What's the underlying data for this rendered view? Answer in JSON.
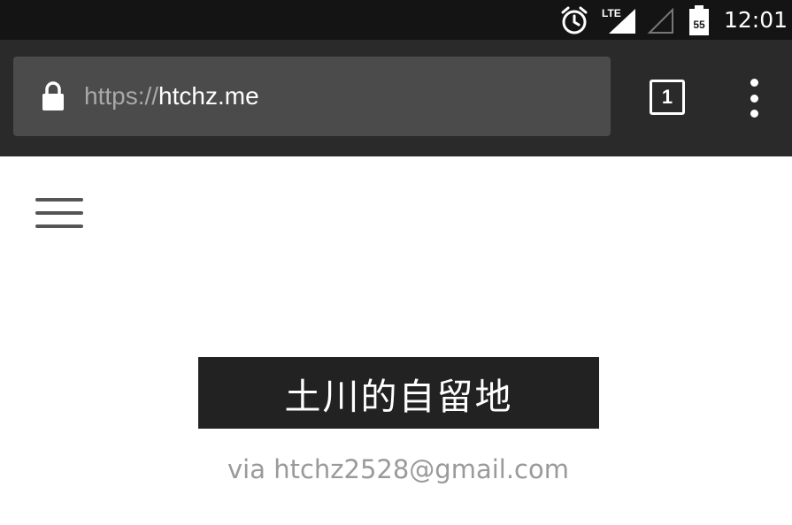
{
  "status_bar": {
    "time": "12:01",
    "network": "LTE",
    "battery_level": "55",
    "icons": [
      "alarm-icon",
      "lte-signal-icon",
      "signal-empty-icon",
      "battery-icon"
    ]
  },
  "browser": {
    "url_scheme": "https://",
    "url_host": "htchz.me",
    "tab_count": "1",
    "icons": [
      "lock-icon",
      "tabs-icon",
      "overflow-menu-icon"
    ]
  },
  "page": {
    "menu_icon": "hamburger-menu-icon",
    "site_title": "土川的自留地",
    "contact": "via htchz2528@gmail.com"
  },
  "colors": {
    "status_bar_bg": "#141414",
    "toolbar_bg": "#2a2a2a",
    "url_bar_bg": "#4b4b4b",
    "title_bg": "#222222",
    "contact_text": "#9a9a9a"
  }
}
